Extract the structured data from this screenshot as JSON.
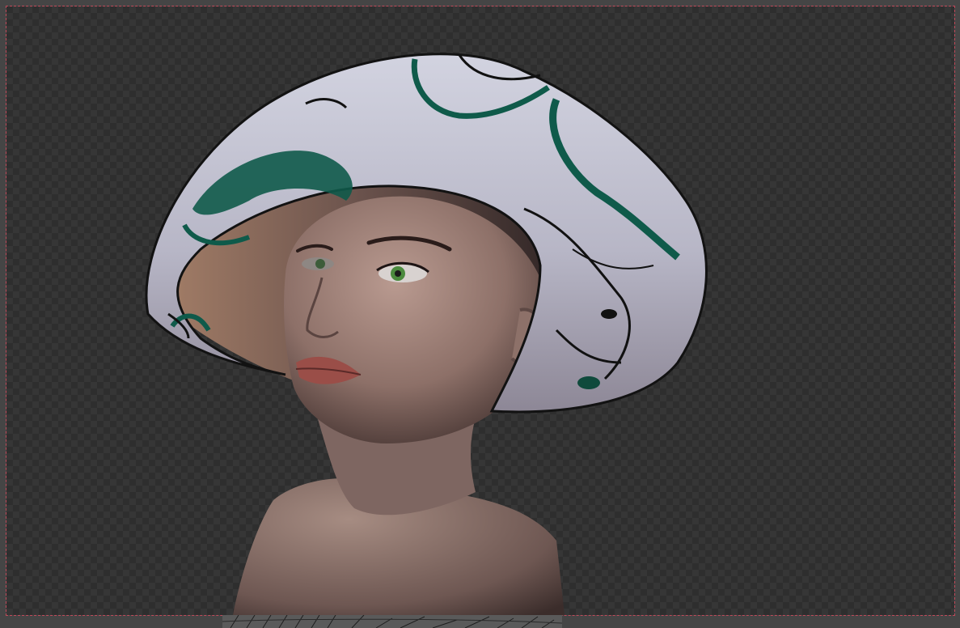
{
  "viewport": {
    "mode": "rendered-view",
    "background": "transparent-checker"
  },
  "render": {
    "subject": "portrait",
    "colors": {
      "hat": "#c9c9d6",
      "hat_pattern_green": "#0f5a4a",
      "hat_pattern_dark": "#111111",
      "skin": "#a98c84",
      "frame_border": "#c04a5a"
    }
  }
}
